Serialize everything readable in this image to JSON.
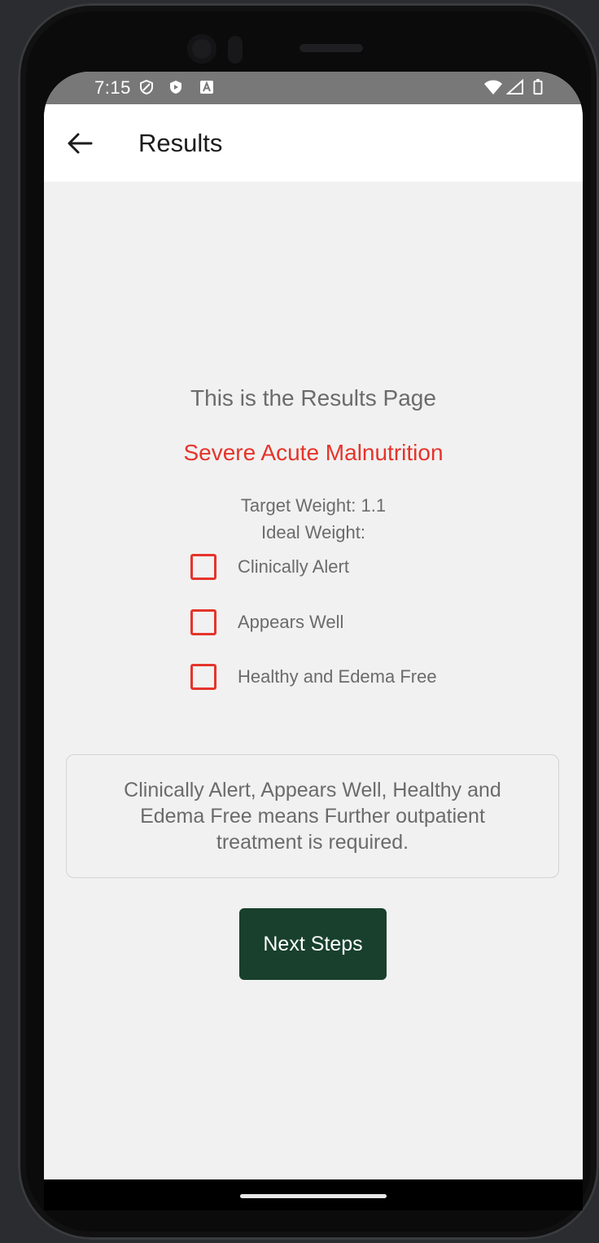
{
  "status_bar": {
    "time": "7:15",
    "left_icons": [
      "shield-icon",
      "play-protect-icon",
      "a-badge-icon"
    ],
    "right_icons": [
      "wifi-icon",
      "signal-icon",
      "battery-icon"
    ]
  },
  "app_bar": {
    "title": "Results",
    "back_icon": "arrow-left-icon"
  },
  "main": {
    "heading": "This is the Results Page",
    "diagnosis": "Severe Acute Malnutrition",
    "target_weight": "Target Weight: 1.1",
    "ideal_weight": "Ideal Weight:",
    "checklist": [
      {
        "label": "Clinically Alert",
        "checked": false
      },
      {
        "label": "Appears Well",
        "checked": false
      },
      {
        "label": "Healthy and Edema Free",
        "checked": false
      }
    ],
    "info_text": "Clinically Alert, Appears Well, Healthy and Edema Free means Further outpatient treatment is required.",
    "next_button_label": "Next Steps"
  },
  "colors": {
    "accent_red": "#e5342b",
    "button_green": "#18402d",
    "background": "#f1f1f1",
    "status_bar": "#787878"
  }
}
